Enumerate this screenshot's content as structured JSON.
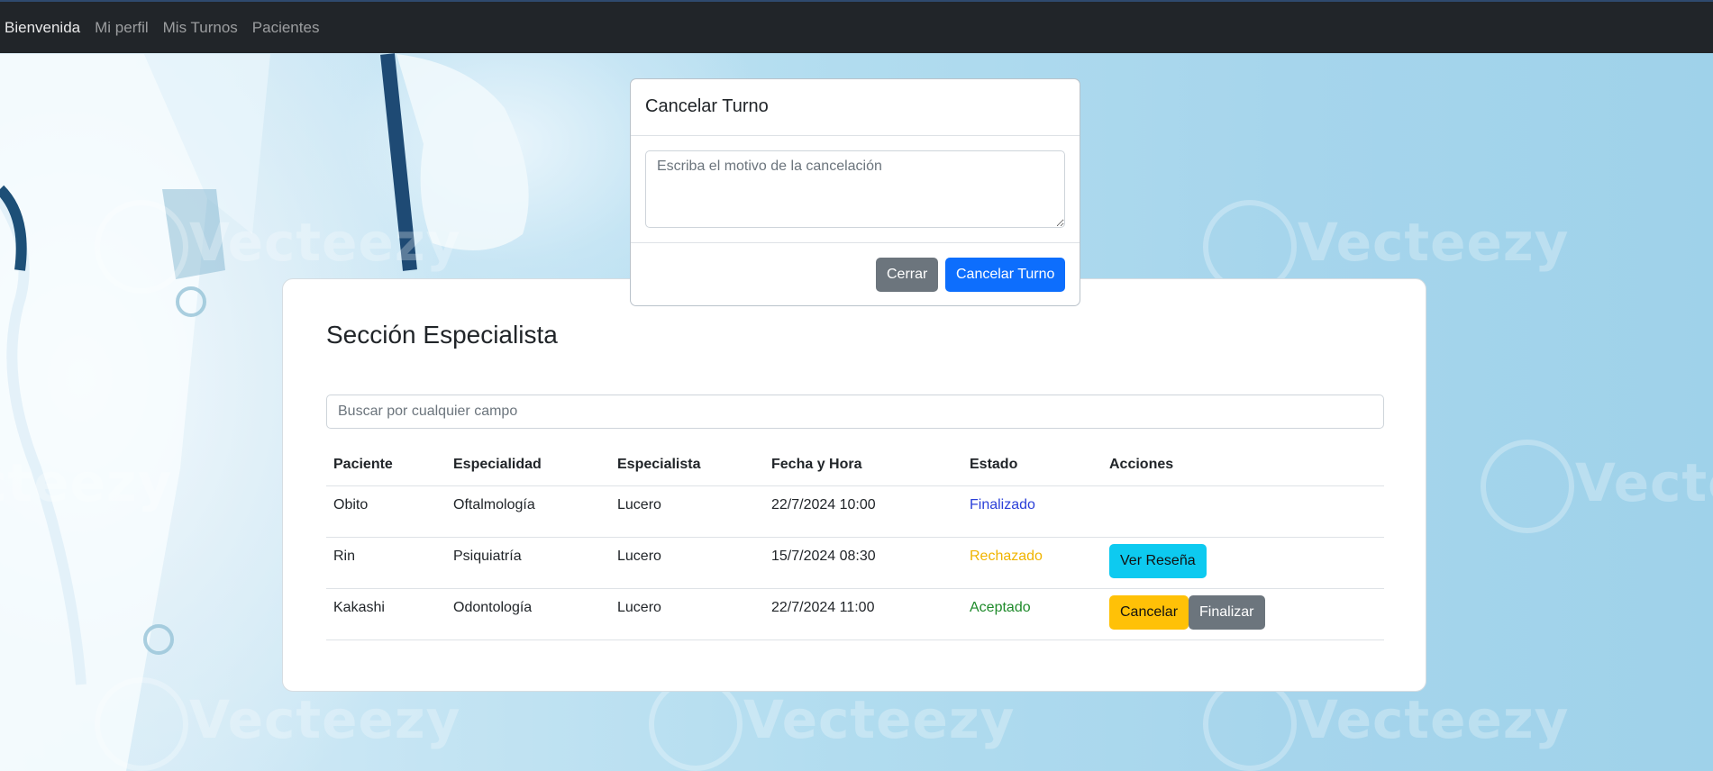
{
  "navbar": {
    "links": [
      {
        "label": "Bienvenida"
      },
      {
        "label": "Mi perfil"
      },
      {
        "label": "Mis Turnos"
      },
      {
        "label": "Pacientes"
      }
    ]
  },
  "background": {
    "watermark_text": "Vecteezy"
  },
  "section": {
    "title": "Sección Especialista",
    "search_placeholder": "Buscar por cualquier campo"
  },
  "table": {
    "headers": [
      "Paciente",
      "Especialidad",
      "Especialista",
      "Fecha y Hora",
      "Estado",
      "Acciones"
    ],
    "rows": [
      {
        "paciente": "Obito",
        "especialidad": "Oftalmología",
        "especialista": "Lucero",
        "fecha_hora": "22/7/2024 10:00",
        "estado": "Finalizado",
        "acciones": []
      },
      {
        "paciente": "Rin",
        "especialidad": "Psiquiatría",
        "especialista": "Lucero",
        "fecha_hora": "15/7/2024 08:30",
        "estado": "Rechazado",
        "acciones": [
          "Ver Reseña"
        ]
      },
      {
        "paciente": "Kakashi",
        "especialidad": "Odontología",
        "especialista": "Lucero",
        "fecha_hora": "22/7/2024 11:00",
        "estado": "Aceptado",
        "acciones": [
          "Cancelar",
          "Finalizar"
        ]
      }
    ]
  },
  "modal": {
    "title": "Cancelar Turno",
    "textarea_placeholder": "Escriba el motivo de la cancelación",
    "textarea_value": "",
    "close_label": "Cerrar",
    "confirm_label": "Cancelar Turno"
  },
  "colors": {
    "navbar": "#212529",
    "primary": "#0d6efd",
    "info": "#0dcaf0",
    "warning": "#ffc107",
    "secondary": "#6c757d",
    "estado_finalizado": "#2a3fd8",
    "estado_rechazado": "#f0b400",
    "estado_aceptado": "#1e8a2a"
  }
}
